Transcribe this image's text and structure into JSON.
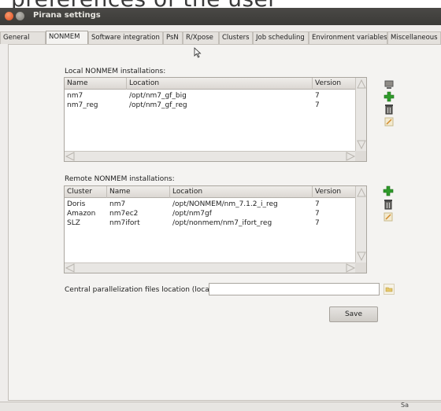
{
  "background_text": "preferences of the user",
  "window": {
    "title": "Pirana settings"
  },
  "tabs": [
    {
      "label": "General"
    },
    {
      "label": "NONMEM",
      "active": true
    },
    {
      "label": "Software integration"
    },
    {
      "label": "PsN"
    },
    {
      "label": "R/Xpose"
    },
    {
      "label": "Clusters"
    },
    {
      "label": "Job scheduling"
    },
    {
      "label": "Environment variables"
    },
    {
      "label": "Miscellaneous"
    }
  ],
  "local": {
    "heading": "Local NONMEM installations:",
    "columns": [
      "Name",
      "Location",
      "Version"
    ],
    "rows": [
      {
        "name": "nm7",
        "location": "/opt/nm7_gf_big",
        "version": "7"
      },
      {
        "name": "nm7_reg",
        "location": "/opt/nm7_gf_reg",
        "version": "7"
      }
    ]
  },
  "remote": {
    "heading": "Remote NONMEM installations:",
    "columns": [
      "Cluster",
      "Name",
      "Location",
      "Version"
    ],
    "rows": [
      {
        "cluster": "Doris",
        "name": "nm7",
        "location": "/opt/NONMEM/nm_7.1.2_i_reg",
        "version": "7"
      },
      {
        "cluster": "Amazon",
        "name": "nm7ec2",
        "location": "/opt/nm7gf",
        "version": "7"
      },
      {
        "cluster": "SLZ",
        "name": "nm7ifort",
        "location": "/opt/nonmem/nm7_ifort_reg",
        "version": "7"
      }
    ]
  },
  "central": {
    "label": "Central parallelization files location (local):",
    "value": ""
  },
  "save_label": "Save",
  "bottom_text": "Sa",
  "colors": {
    "add": "#2f9a2a",
    "folder": "#e5c76a",
    "titlebar": "#3b3a37",
    "close": "#e0491b"
  },
  "icons": [
    "computer-icon",
    "add-icon",
    "trash-icon",
    "edit-icon",
    "folder-icon"
  ]
}
